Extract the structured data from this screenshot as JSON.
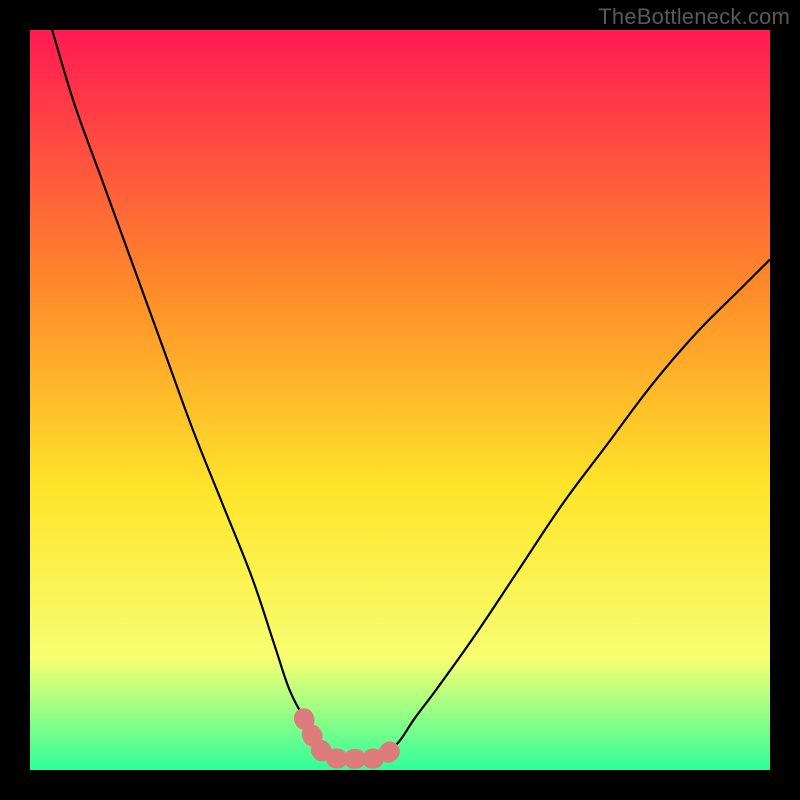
{
  "watermark": "TheBottleneck.com",
  "chart_data": {
    "type": "line",
    "title": "",
    "xlabel": "",
    "ylabel": "",
    "xlim": [
      0,
      100
    ],
    "ylim": [
      0,
      100
    ],
    "background_gradient": {
      "top": "#ff1a53",
      "mid1": "#ff8b2a",
      "mid2": "#ffe52a",
      "mid3": "#f7ff73",
      "bottom": "#2fff9a"
    },
    "series": [
      {
        "name": "left-curve",
        "x": [
          3,
          6,
          10,
          14,
          18,
          22,
          26,
          30,
          33,
          35,
          37,
          38.5,
          40
        ],
        "values": [
          100,
          90,
          79,
          68,
          57,
          46,
          36,
          26,
          17,
          11,
          7,
          4,
          2
        ]
      },
      {
        "name": "right-curve",
        "x": [
          48,
          50,
          52,
          55,
          60,
          66,
          72,
          78,
          84,
          90,
          96,
          100
        ],
        "values": [
          2,
          4,
          7,
          11,
          18,
          27,
          36,
          44,
          52,
          59,
          65,
          69
        ]
      },
      {
        "name": "highlight-region",
        "x": [
          37,
          38.5,
          40,
          42,
          44,
          46,
          48,
          50
        ],
        "values": [
          7,
          4,
          2,
          1.5,
          1.5,
          1.5,
          2,
          4
        ]
      }
    ],
    "highlight_color": "#de7b7b",
    "curve_color": "#000000",
    "frame_color": "#000000"
  }
}
